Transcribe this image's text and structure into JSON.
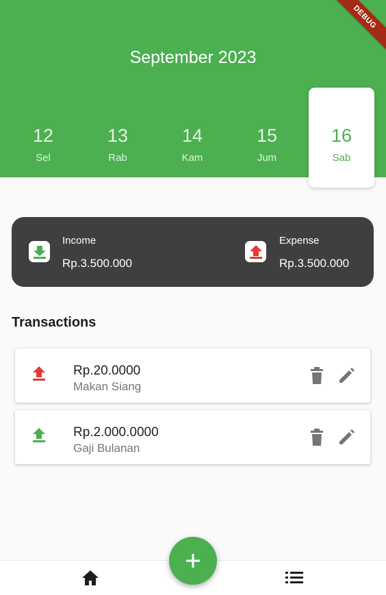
{
  "debug_banner": "DEBUG",
  "header": {
    "month": "September 2023"
  },
  "days": [
    {
      "num": "12",
      "name": "Sel",
      "selected": false
    },
    {
      "num": "13",
      "name": "Rab",
      "selected": false
    },
    {
      "num": "14",
      "name": "Kam",
      "selected": false
    },
    {
      "num": "15",
      "name": "Jum",
      "selected": false
    },
    {
      "num": "16",
      "name": "Sab",
      "selected": true
    }
  ],
  "summary": {
    "income": {
      "label": "Income",
      "value": "Rp.3.500.000",
      "icon": "download-icon"
    },
    "expense": {
      "label": "Expense",
      "value": "Rp.3.500.000",
      "icon": "upload-icon"
    }
  },
  "section_title": "Transactions",
  "transactions": [
    {
      "amount": "Rp.20.0000",
      "description": "Makan Siang",
      "type": "expense",
      "icon": "upload-icon"
    },
    {
      "amount": "Rp.2.000.0000",
      "description": "Gaji Bulanan",
      "type": "income",
      "icon": "upload-icon"
    }
  ],
  "colors": {
    "primary": "#4caf50",
    "expense": "#e53935",
    "card_dark": "#3f3f3f",
    "icon_gray": "#757575"
  },
  "nav": {
    "home_icon": "home-icon",
    "list_icon": "list-icon",
    "fab_icon": "plus-icon"
  }
}
